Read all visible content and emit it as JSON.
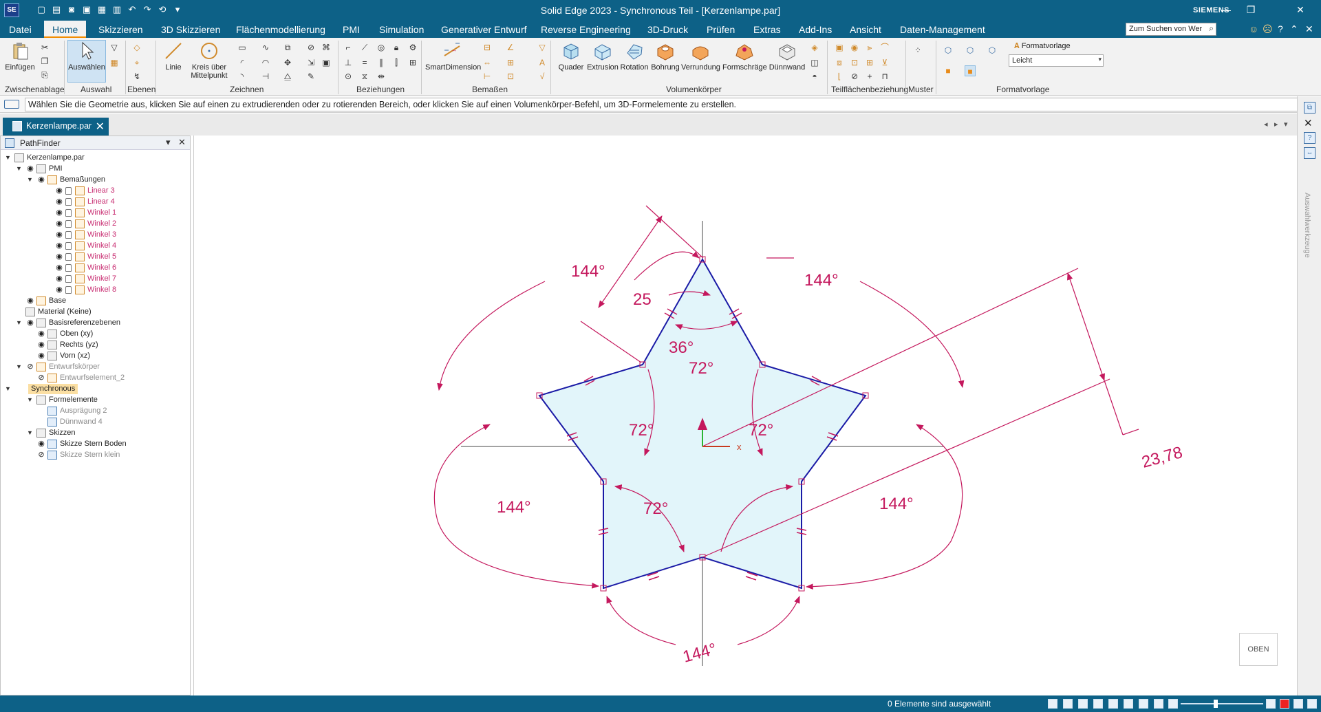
{
  "app": {
    "title": "Solid Edge 2023 - Synchronous Teil - [Kerzenlampe.par]",
    "brand": "SIEMENS",
    "logo": "SE"
  },
  "menu": {
    "tabs": [
      "Datei",
      "Home",
      "Skizzieren",
      "3D Skizzieren",
      "Flächenmodellierung",
      "PMI",
      "Simulation",
      "Generativer Entwurf",
      "Reverse Engineering",
      "3D-Druck",
      "Prüfen",
      "Extras",
      "Add-Ins",
      "Ansicht",
      "Daten-Management"
    ],
    "active": "Home",
    "search_text": "Zum Suchen von Wer"
  },
  "ribbon": {
    "buttons": {
      "einfuegen": "Einfügen",
      "auswaehlen": "Auswählen",
      "linie": "Linie",
      "kreis1": "Kreis über",
      "kreis2": "Mittelpunkt",
      "smartdimension": "SmartDimension",
      "quader": "Quader",
      "extrusion": "Extrusion",
      "rotation": "Rotation",
      "bohrung": "Bohrung",
      "verrundung": "Verrundung",
      "formschraege": "Formschräge",
      "duennwand": "Dünnwand"
    },
    "groups": {
      "zwischenablage": "Zwischenablage",
      "auswahl": "Auswahl",
      "ebenen": "Ebenen",
      "zeichnen": "Zeichnen",
      "beziehungen": "Beziehungen",
      "bemassen": "Bemaßen",
      "volumenkoerper": "Volumenkörper",
      "teilflaechen": "Teilflächenbeziehung",
      "muster": "Muster",
      "formatvorlage": "Formatvorlage"
    },
    "formatvorlage_label": "Formatvorlage",
    "formatvorlage_value": "Leicht"
  },
  "prompt": "Wählen Sie die Geometrie aus, klicken Sie auf einen zu extrudierenden oder zu rotierenden Bereich, oder klicken Sie auf einen Volumenkörper-Befehl, um 3D-Formelemente zu erstellen.",
  "document_tab": "Kerzenlampe.par",
  "pathfinder": {
    "title": "PathFinder",
    "nodes": [
      {
        "label": "Kerzenlampe.par"
      },
      {
        "label": "PMI"
      },
      {
        "label": "Bemaßungen"
      },
      {
        "label": "Linear 3"
      },
      {
        "label": "Linear 4"
      },
      {
        "label": "Winkel 1"
      },
      {
        "label": "Winkel 2"
      },
      {
        "label": "Winkel 3"
      },
      {
        "label": "Winkel 4"
      },
      {
        "label": "Winkel 5"
      },
      {
        "label": "Winkel 6"
      },
      {
        "label": "Winkel 7"
      },
      {
        "label": "Winkel 8"
      },
      {
        "label": "Base"
      },
      {
        "label": "Material (Keine)"
      },
      {
        "label": "Basisreferenzebenen"
      },
      {
        "label": "Oben (xy)"
      },
      {
        "label": "Rechts (yz)"
      },
      {
        "label": "Vorn (xz)"
      },
      {
        "label": "Entwurfskörper"
      },
      {
        "label": "Entwurfselement_2"
      },
      {
        "label": "Synchronous"
      },
      {
        "label": "Formelemente"
      },
      {
        "label": "Ausprägung 2"
      },
      {
        "label": "Dünnwand 4"
      },
      {
        "label": "Skizzen"
      },
      {
        "label": "Skizze Stern Boden"
      },
      {
        "label": "Skizze Stern klein"
      }
    ]
  },
  "sketch": {
    "dims": {
      "d144_tl": "144°",
      "d144_tr": "144°",
      "d144_l": "144°",
      "d144_r": "144°",
      "d144_b": "144°",
      "d25": "25",
      "d36": "36°",
      "d72_top": "72°",
      "d72_l": "72°",
      "d72_r": "72°",
      "d72_b": "72°",
      "d2378": "23,78"
    },
    "axis_x_label": "x",
    "colors": {
      "profile": "#1a1aa6",
      "dimension": "#c4185d",
      "fill": "#e2f5fa"
    }
  },
  "rightpanel": {
    "label": "Auswahlwerkzeuge"
  },
  "viewcube_label": "OBEN",
  "status": {
    "message": "0 Elemente sind ausgewählt"
  }
}
